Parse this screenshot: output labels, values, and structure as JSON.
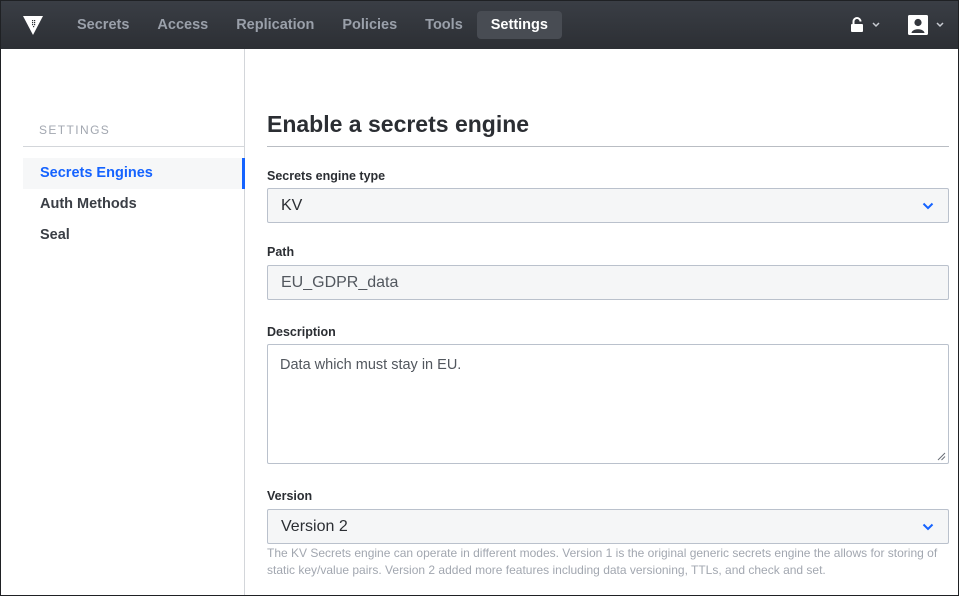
{
  "nav": {
    "items": [
      {
        "label": "Secrets",
        "active": false
      },
      {
        "label": "Access",
        "active": false
      },
      {
        "label": "Replication",
        "active": false
      },
      {
        "label": "Policies",
        "active": false
      },
      {
        "label": "Tools",
        "active": false
      },
      {
        "label": "Settings",
        "active": true
      }
    ],
    "icons": {
      "logo": "vault-logo-icon",
      "status": "unlock-icon",
      "user": "user-avatar-icon"
    }
  },
  "sidebar": {
    "heading": "SETTINGS",
    "items": [
      {
        "label": "Secrets Engines",
        "active": true
      },
      {
        "label": "Auth Methods",
        "active": false
      },
      {
        "label": "Seal",
        "active": false
      }
    ]
  },
  "form": {
    "title": "Enable a secrets engine",
    "engine_type": {
      "label": "Secrets engine type",
      "value": "KV"
    },
    "path": {
      "label": "Path",
      "value": "EU_GDPR_data"
    },
    "description": {
      "label": "Description",
      "value": "Data which must stay in EU."
    },
    "version": {
      "label": "Version",
      "value": "Version 2",
      "help": "The KV Secrets engine can operate in different modes. Version 1 is the original generic secrets engine the allows for storing of static key/value pairs. Version 2 added more features including data versioning, TTLs, and check and set."
    }
  },
  "colors": {
    "accent": "#1563ff",
    "topbar": "#33363c",
    "muted": "#a2a7b0"
  }
}
